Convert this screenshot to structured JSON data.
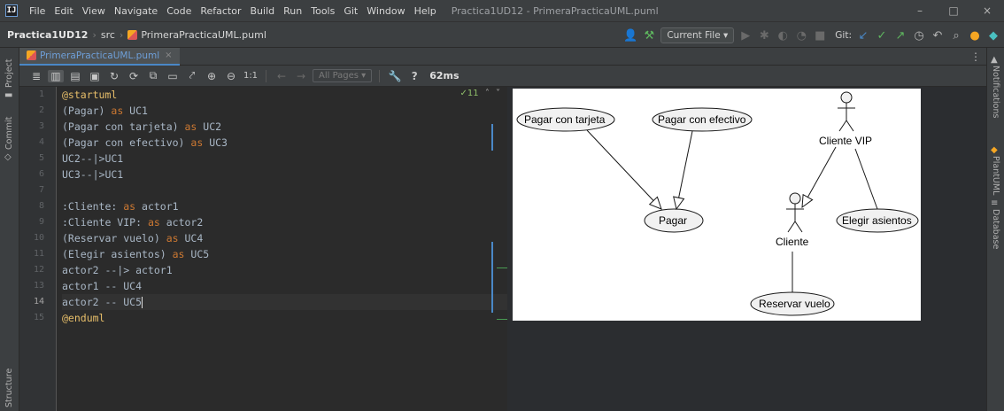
{
  "app": {
    "logo": "IJ",
    "menu": [
      "File",
      "Edit",
      "View",
      "Navigate",
      "Code",
      "Refactor",
      "Build",
      "Run",
      "Tools",
      "Git",
      "Window",
      "Help"
    ],
    "window_title": "Practica1UD12 - PrimeraPracticaUML.puml",
    "window_controls": {
      "minimize": "–",
      "maximize": "□",
      "close": "×"
    }
  },
  "navbar": {
    "breadcrumb": [
      "Practica1UD12",
      "src",
      "PrimeraPracticaUML.puml"
    ],
    "run_config": "Current File ▾",
    "git_label": "Git:"
  },
  "tool_windows": {
    "left": [
      "Project",
      "Commit",
      "Structure"
    ],
    "right": [
      "Notifications",
      "PlantUML",
      "Database"
    ]
  },
  "tab": {
    "label": "PrimeraPracticaUML.puml",
    "close": "×"
  },
  "preview_toolbar": {
    "zoom_1to1": "1:1",
    "pages_dropdown": "All Pages ▾",
    "help": "?",
    "render_time": "62ms"
  },
  "editor": {
    "inspection": "✓11",
    "current_line": 14,
    "lines": [
      "@startuml",
      "(Pagar) as UC1",
      "(Pagar con tarjeta) as UC2",
      "(Pagar con efectivo) as UC3",
      "UC2--|>UC1",
      "UC3--|>UC1",
      "",
      ":Cliente: as actor1",
      ":Cliente VIP: as actor2",
      "(Reservar vuelo) as UC4",
      "(Elegir asientos) as UC5",
      "actor2 --|> actor1",
      "actor1 -- UC4",
      "actor2 -- UC5",
      "@enduml"
    ]
  },
  "diagram": {
    "use_cases": {
      "pagar_con_tarjeta": "Pagar con tarjeta",
      "pagar_con_efectivo": "Pagar con efectivo",
      "pagar": "Pagar",
      "elegir_asientos": "Elegir asientos",
      "reservar_vuelo": "Reservar vuelo"
    },
    "actors": {
      "cliente_vip": "Cliente VIP",
      "cliente": "Cliente"
    }
  }
}
